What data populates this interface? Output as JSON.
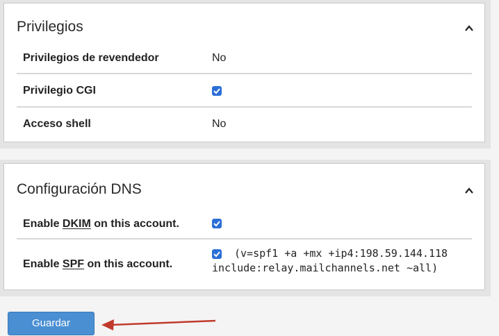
{
  "privileges": {
    "title": "Privilegios",
    "rows": [
      {
        "label": "Privilegios de revendedor",
        "value": "No"
      },
      {
        "label": "Privilegio CGI",
        "checked": true
      },
      {
        "label": "Acceso shell",
        "value": "No"
      }
    ]
  },
  "dns": {
    "title": "Configuración DNS",
    "dkim": {
      "pre": "Enable ",
      "key": "DKIM",
      "post": " on this account.",
      "checked": true
    },
    "spf": {
      "pre": "Enable ",
      "key": "SPF",
      "post": " on this account.",
      "checked": true,
      "record_line1": "(v=spf1 +a +mx +ip4:198.59.144.118",
      "record_line2": "include:relay.mailchannels.net ~all)"
    }
  },
  "save_label": "Guardar",
  "colors": {
    "checkbox": "#2b6fd6",
    "button": "#4a8fd2",
    "arrow": "#c0392b"
  },
  "icons": {
    "collapse": "chevron-up-icon",
    "check": "checkbox-checked-icon"
  }
}
